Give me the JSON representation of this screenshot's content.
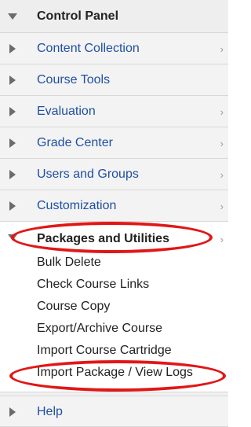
{
  "control_panel": {
    "title": "Control Panel"
  },
  "menu": {
    "items": [
      {
        "label": "Content Collection",
        "has_arrow": true
      },
      {
        "label": "Course Tools",
        "has_arrow": false
      },
      {
        "label": "Evaluation",
        "has_arrow": true
      },
      {
        "label": "Grade Center",
        "has_arrow": true
      },
      {
        "label": "Users and Groups",
        "has_arrow": true
      },
      {
        "label": "Customization",
        "has_arrow": true
      }
    ],
    "expanded": {
      "label": "Packages and Utilities",
      "subitems": [
        "Bulk Delete",
        "Check Course Links",
        "Course Copy",
        "Export/Archive Course",
        "Import Course Cartridge",
        "Import Package / View Logs"
      ]
    },
    "help": {
      "label": "Help"
    }
  },
  "chevron_char": "›",
  "colors": {
    "link": "#1f4fa3",
    "highlight": "#e11717"
  }
}
